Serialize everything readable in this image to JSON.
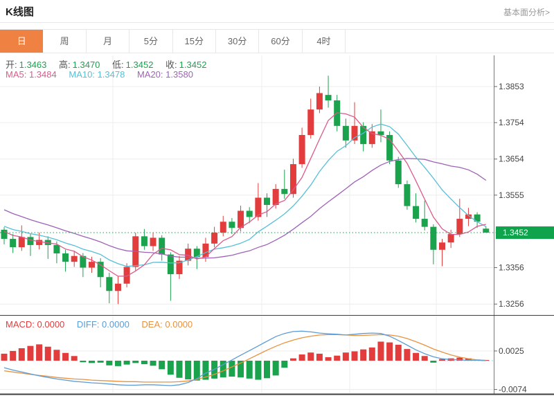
{
  "header": {
    "title": "K线图",
    "link": "基本面分析>"
  },
  "tabs": [
    {
      "name": "day",
      "label": "日",
      "active": true
    },
    {
      "name": "week",
      "label": "周",
      "active": false
    },
    {
      "name": "month",
      "label": "月",
      "active": false
    },
    {
      "name": "5min",
      "label": "5分",
      "active": false
    },
    {
      "name": "15min",
      "label": "15分",
      "active": false
    },
    {
      "name": "30min",
      "label": "30分",
      "active": false
    },
    {
      "name": "60min",
      "label": "60分",
      "active": false
    },
    {
      "name": "4hour",
      "label": "4时",
      "active": false
    }
  ],
  "legend": {
    "ohlc": [
      {
        "label": "开:",
        "value": "1.3463"
      },
      {
        "label": "高:",
        "value": "1.3470"
      },
      {
        "label": "低:",
        "value": "1.3452"
      },
      {
        "label": "收:",
        "value": "1.3452"
      }
    ],
    "ma": [
      {
        "label": "MA5:",
        "value": "1.3484"
      },
      {
        "label": "MA10:",
        "value": "1.3478"
      },
      {
        "label": "MA20:",
        "value": "1.3580"
      }
    ],
    "macd": [
      {
        "label": "MACD:",
        "value": "0.0000"
      },
      {
        "label": "DIFF:",
        "value": "0.0000"
      },
      {
        "label": "DEA:",
        "value": "0.0000"
      }
    ]
  },
  "colors": {
    "accent": "#ef8143",
    "up": "#e23c3c",
    "down": "#1ba24d",
    "tag": "#0fa34c",
    "ma5": "#db5a8c",
    "ma10": "#56bfd8",
    "ma20": "#9d62b8",
    "diff": "#5b9bd5",
    "dea": "#e8923f",
    "grid": "#ececec",
    "axis_text": "#444",
    "dark_border": "#3c3c3c"
  },
  "chart_data": {
    "type": "candlestick",
    "title": "K线图",
    "legend_position": "top-left",
    "grid": true,
    "price_axis": {
      "labels": [
        1.3853,
        1.3754,
        1.3654,
        1.3555,
        1.3356,
        1.3256
      ],
      "current": 1.3452,
      "ylim": [
        1.3235,
        1.3895
      ]
    },
    "vgrid": [
      163,
      378,
      505,
      630
    ],
    "candles": [
      [
        1.346,
        1.3467,
        1.342,
        1.3435
      ],
      [
        1.3435,
        1.3448,
        1.3396,
        1.3412
      ],
      [
        1.3412,
        1.3472,
        1.3402,
        1.344
      ],
      [
        1.344,
        1.345,
        1.3388,
        1.3418
      ],
      [
        1.3418,
        1.3452,
        1.3406,
        1.3432
      ],
      [
        1.3432,
        1.3442,
        1.338,
        1.3418
      ],
      [
        1.3418,
        1.3428,
        1.3368,
        1.3395
      ],
      [
        1.3395,
        1.3405,
        1.3345,
        1.3372
      ],
      [
        1.3372,
        1.3402,
        1.3358,
        1.3388
      ],
      [
        1.3388,
        1.3396,
        1.333,
        1.3356
      ],
      [
        1.3356,
        1.3386,
        1.3342,
        1.3372
      ],
      [
        1.3372,
        1.3382,
        1.3302,
        1.333
      ],
      [
        1.333,
        1.3342,
        1.3258,
        1.3292
      ],
      [
        1.3292,
        1.3332,
        1.3256,
        1.3312
      ],
      [
        1.3312,
        1.3368,
        1.3302,
        1.3358
      ],
      [
        1.3358,
        1.3452,
        1.3348,
        1.3442
      ],
      [
        1.3442,
        1.3462,
        1.3405,
        1.3415
      ],
      [
        1.3415,
        1.3452,
        1.3402,
        1.3438
      ],
      [
        1.3438,
        1.3445,
        1.3375,
        1.3392
      ],
      [
        1.3392,
        1.3398,
        1.3265,
        1.3338
      ],
      [
        1.3338,
        1.3388,
        1.3325,
        1.3375
      ],
      [
        1.3375,
        1.3422,
        1.3362,
        1.3408
      ],
      [
        1.3408,
        1.3415,
        1.3352,
        1.3385
      ],
      [
        1.3385,
        1.3438,
        1.3372,
        1.3422
      ],
      [
        1.3422,
        1.3468,
        1.3412,
        1.3452
      ],
      [
        1.3452,
        1.3498,
        1.3442,
        1.3482
      ],
      [
        1.3482,
        1.3492,
        1.3448,
        1.3465
      ],
      [
        1.3465,
        1.3526,
        1.3455,
        1.3512
      ],
      [
        1.3512,
        1.3522,
        1.3478,
        1.3495
      ],
      [
        1.3495,
        1.3588,
        1.3485,
        1.3548
      ],
      [
        1.3548,
        1.356,
        1.3495,
        1.3528
      ],
      [
        1.3528,
        1.3585,
        1.3518,
        1.3572
      ],
      [
        1.3572,
        1.3625,
        1.3545,
        1.3558
      ],
      [
        1.3558,
        1.3655,
        1.3548,
        1.364
      ],
      [
        1.364,
        1.374,
        1.363,
        1.372
      ],
      [
        1.372,
        1.382,
        1.371,
        1.379
      ],
      [
        1.379,
        1.3853,
        1.378,
        1.3835
      ],
      [
        1.383,
        1.3883,
        1.3795,
        1.3815
      ],
      [
        1.3815,
        1.383,
        1.373,
        1.3745
      ],
      [
        1.3745,
        1.3765,
        1.3685,
        1.3705
      ],
      [
        1.3705,
        1.381,
        1.3695,
        1.3745
      ],
      [
        1.3745,
        1.3755,
        1.3675,
        1.3695
      ],
      [
        1.3695,
        1.375,
        1.3685,
        1.373
      ],
      [
        1.373,
        1.379,
        1.37,
        1.372
      ],
      [
        1.372,
        1.373,
        1.364,
        1.365
      ],
      [
        1.365,
        1.366,
        1.3575,
        1.3585
      ],
      [
        1.3585,
        1.3595,
        1.3515,
        1.3525
      ],
      [
        1.3525,
        1.356,
        1.348,
        1.349
      ],
      [
        1.349,
        1.354,
        1.3458,
        1.3468
      ],
      [
        1.3468,
        1.3475,
        1.3365,
        1.3405
      ],
      [
        1.3405,
        1.3435,
        1.336,
        1.3425
      ],
      [
        1.3425,
        1.346,
        1.341,
        1.3448
      ],
      [
        1.3448,
        1.3545,
        1.344,
        1.349
      ],
      [
        1.349,
        1.352,
        1.347,
        1.3502
      ],
      [
        1.3502,
        1.3508,
        1.3465,
        1.3482
      ],
      [
        1.3463,
        1.347,
        1.3452,
        1.3452
      ]
    ],
    "ma_pre_closes": [
      1.362,
      1.3605,
      1.359,
      1.3575,
      1.356,
      1.355,
      1.354,
      1.353,
      1.352,
      1.351,
      1.35,
      1.349,
      1.3482,
      1.3476,
      1.347,
      1.3466,
      1.3462,
      1.3458,
      1.3455
    ],
    "macd": {
      "axis_labels": [
        0.0025,
        -0.0074
      ],
      "hist": [
        0.0018,
        0.0025,
        0.0032,
        0.0038,
        0.0042,
        0.0036,
        0.0028,
        0.002,
        0.0012,
        -0.0004,
        -0.0006,
        -0.0005,
        -0.0012,
        -0.0014,
        -0.001,
        -0.0006,
        -0.0009,
        -0.0013,
        -0.0022,
        -0.0036,
        -0.0044,
        -0.0048,
        -0.0051,
        -0.0049,
        -0.0046,
        -0.0043,
        -0.0041,
        -0.0043,
        -0.0046,
        -0.0049,
        -0.0045,
        -0.0038,
        -0.0018,
        0.0006,
        0.0016,
        0.0021,
        0.0018,
        0.0009,
        0.0013,
        0.0021,
        0.0024,
        0.0029,
        0.0034,
        0.0049,
        0.0047,
        0.0041,
        0.003,
        0.002,
        0.0012,
        -0.0005,
        0.0004,
        0.0006,
        0.0008,
        0.0006,
        0.0003,
        0.0001
      ],
      "diff": [
        -0.0018,
        -0.0024,
        -0.0029,
        -0.0034,
        -0.0039,
        -0.0043,
        -0.0047,
        -0.005,
        -0.0053,
        -0.0055,
        -0.0057,
        -0.0058,
        -0.006,
        -0.0062,
        -0.0063,
        -0.0063,
        -0.0062,
        -0.0062,
        -0.0063,
        -0.0064,
        -0.0062,
        -0.0056,
        -0.0046,
        -0.0032,
        -0.0022,
        -0.001,
        0.0002,
        0.0014,
        0.0026,
        0.0038,
        0.005,
        0.0062,
        0.007,
        0.0075,
        0.0076,
        0.0074,
        0.0071,
        0.0069,
        0.0068,
        0.0066,
        0.0068,
        0.007,
        0.0071,
        0.007,
        0.0063,
        0.0052,
        0.004,
        0.0028,
        0.0018,
        0.001,
        0.0005,
        0.0003,
        0.0002,
        0.0001,
        0.0001,
        0.0
      ],
      "dea": [
        -0.0026,
        -0.0029,
        -0.0032,
        -0.0035,
        -0.0038,
        -0.004,
        -0.0043,
        -0.0045,
        -0.0047,
        -0.0048,
        -0.005,
        -0.0051,
        -0.0052,
        -0.0053,
        -0.0054,
        -0.0054,
        -0.0055,
        -0.0055,
        -0.0055,
        -0.0055,
        -0.0054,
        -0.0052,
        -0.0048,
        -0.0042,
        -0.0035,
        -0.0026,
        -0.0016,
        -0.0006,
        0.0005,
        0.0016,
        0.0027,
        0.0037,
        0.0046,
        0.0053,
        0.0059,
        0.0063,
        0.0066,
        0.0067,
        0.0067,
        0.0066,
        0.0065,
        0.0065,
        0.0066,
        0.0067,
        0.0066,
        0.0063,
        0.0057,
        0.0049,
        0.004,
        0.003,
        0.0022,
        0.0015,
        0.0009,
        0.0005,
        0.0002,
        0.0001
      ]
    }
  }
}
